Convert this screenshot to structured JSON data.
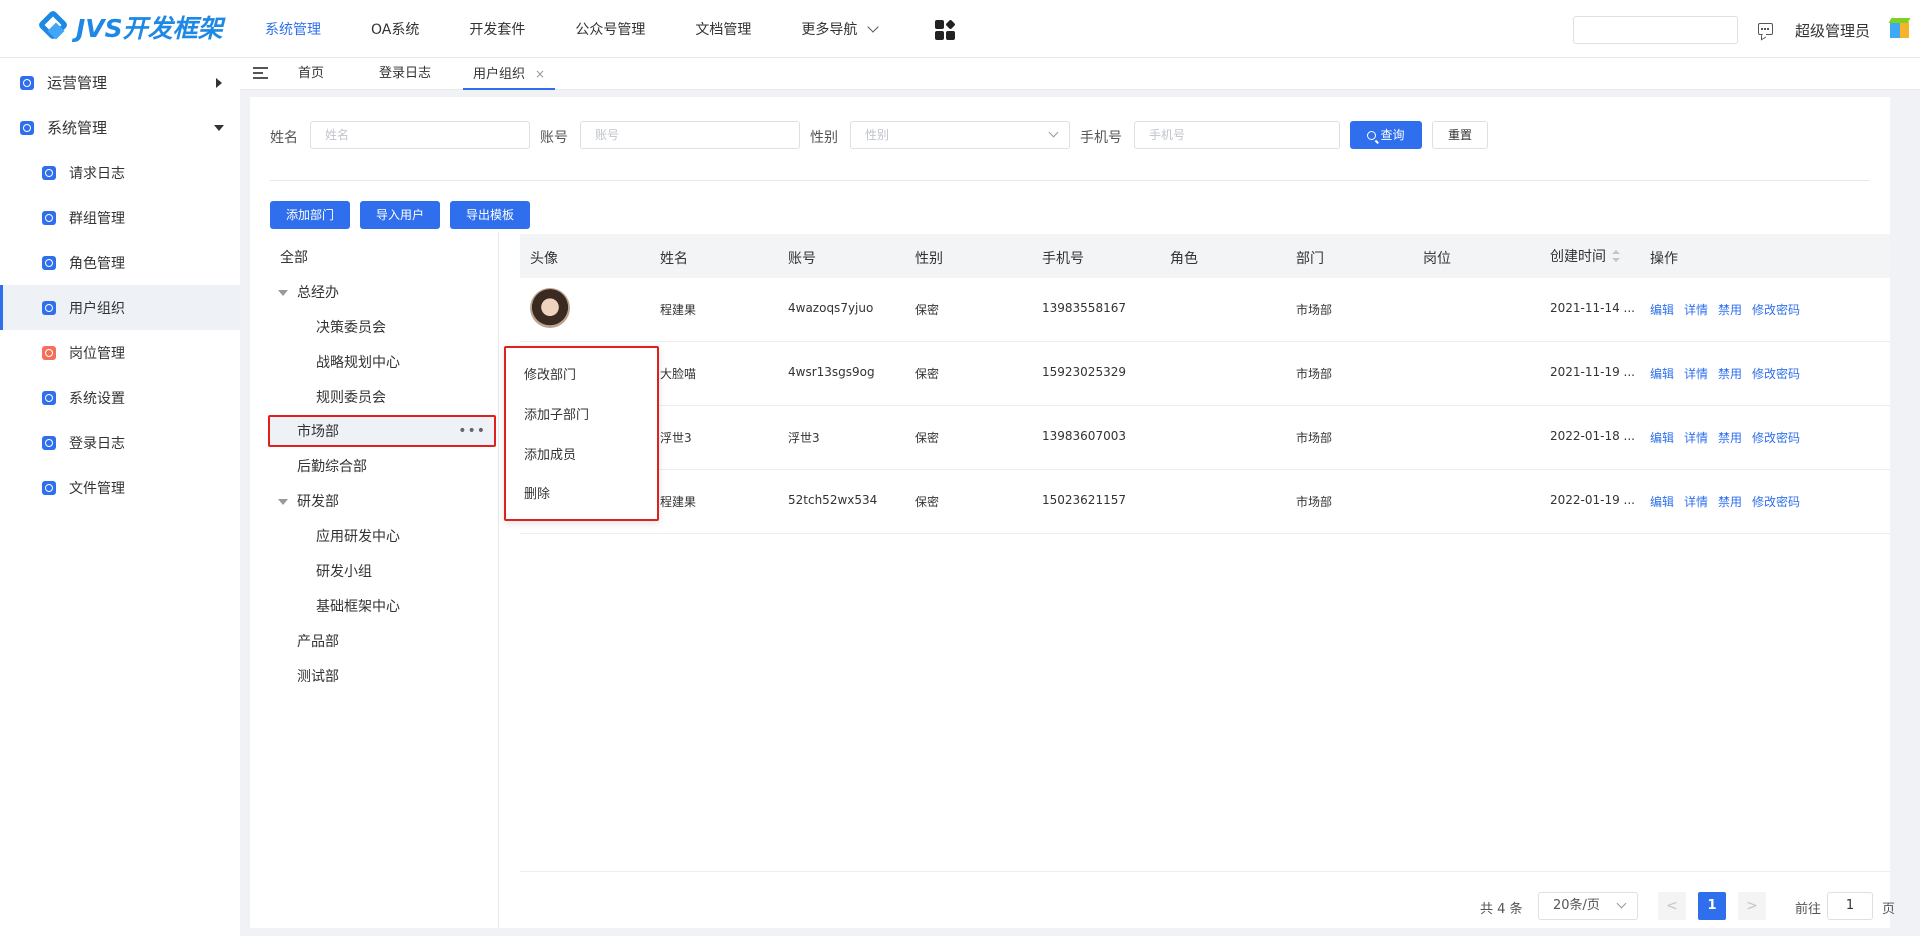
{
  "header": {
    "logo_text": "JVS开发框架",
    "nav": [
      "系统管理",
      "OA系统",
      "开发套件",
      "公众号管理",
      "文档管理",
      "更多导航"
    ],
    "active_nav": "系统管理",
    "user": "超级管理员",
    "colors": {
      "accent": "#2f6fed"
    }
  },
  "sidebar": {
    "groups": [
      {
        "label": "运营管理",
        "expanded": false
      },
      {
        "label": "系统管理",
        "expanded": true
      }
    ],
    "items": [
      "请求日志",
      "群组管理",
      "角色管理",
      "用户组织",
      "岗位管理",
      "系统设置",
      "登录日志",
      "文件管理"
    ],
    "active_item": "用户组织"
  },
  "tabs": {
    "items": [
      "首页",
      "登录日志",
      "用户组织"
    ],
    "active": "用户组织",
    "close_glyph": "×"
  },
  "filters": {
    "name_label": "姓名",
    "name_placeholder": "姓名",
    "account_label": "账号",
    "account_placeholder": "账号",
    "gender_label": "性别",
    "gender_placeholder": "性别",
    "phone_label": "手机号",
    "phone_placeholder": "手机号",
    "search_button": "查询",
    "reset_button": "重置"
  },
  "actions": {
    "add_dept": "添加部门",
    "import_users": "导入用户",
    "export_template": "导出模板"
  },
  "tree": {
    "nodes": [
      "全部",
      "总经办",
      "决策委员会",
      "战略规划中心",
      "规则委员会",
      "市场部",
      "后勤综合部",
      "研发部",
      "应用研发中心",
      "研发小组",
      "基础框架中心",
      "产品部",
      "测试部"
    ],
    "selected": "市场部",
    "more_glyph": "•••"
  },
  "context_menu": {
    "items": [
      "修改部门",
      "添加子部门",
      "添加成员",
      "删除"
    ]
  },
  "table": {
    "columns": [
      "头像",
      "姓名",
      "账号",
      "性别",
      "手机号",
      "角色",
      "部门",
      "岗位",
      "创建时间",
      "操作"
    ],
    "rows": [
      {
        "name": "程建果",
        "account": "4wazoqs7yjuo",
        "gender": "保密",
        "phone": "13983558167",
        "role": "",
        "dept": "市场部",
        "post": "",
        "created": "2021-11-14 ..."
      },
      {
        "name": "大脸喵",
        "account": "4wsr13sgs9og",
        "gender": "保密",
        "phone": "15923025329",
        "role": "",
        "dept": "市场部",
        "post": "",
        "created": "2021-11-19 ..."
      },
      {
        "name": "浮世3",
        "account": "浮世3",
        "gender": "保密",
        "phone": "13983607003",
        "role": "",
        "dept": "市场部",
        "post": "",
        "created": "2022-01-18 ..."
      },
      {
        "name": "程建果",
        "account": "52tch52wx534",
        "gender": "保密",
        "phone": "15023621157",
        "role": "",
        "dept": "市场部",
        "post": "",
        "created": "2022-01-19 ..."
      }
    ],
    "row_actions": [
      "编辑",
      "详情",
      "禁用",
      "修改密码"
    ]
  },
  "pagination": {
    "total": "共 4 条",
    "page_size": "20条/页",
    "current_page": "1",
    "goto_label": "前往",
    "goto_value": "1",
    "page_suffix": "页",
    "prev": "<",
    "next": ">"
  }
}
